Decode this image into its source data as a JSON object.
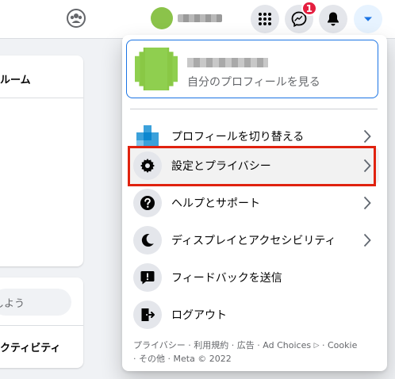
{
  "header": {
    "profile_name": "",
    "notification_count": "1",
    "icons": [
      "groups-icon",
      "menu-grid-icon",
      "messenger-icon",
      "bell-icon",
      "caret-down-icon"
    ],
    "accent_color": "#1b74e4",
    "badge_color": "#e41e3f"
  },
  "background": {
    "card1_title": "ルーム",
    "input_placeholder": "しよう",
    "card2_title": "クティビティ"
  },
  "menu": {
    "profile": {
      "name": "",
      "subtitle": "自分のプロフィールを見る"
    },
    "items": [
      {
        "label": "プロフィールを切り替える",
        "icon": "switch-profile-icon",
        "has_chevron": true
      },
      {
        "label": "設定とプライバシー",
        "icon": "gear-icon",
        "has_chevron": true,
        "highlighted": true
      },
      {
        "label": "ヘルプとサポート",
        "icon": "question-icon",
        "has_chevron": true
      },
      {
        "label": "ディスプレイとアクセシビリティ",
        "icon": "moon-icon",
        "has_chevron": true
      },
      {
        "label": "フィードバックを送信",
        "icon": "feedback-icon",
        "has_chevron": false
      },
      {
        "label": "ログアウト",
        "icon": "logout-icon",
        "has_chevron": false
      }
    ],
    "footer": {
      "privacy": "プライバシー",
      "terms": "利用規約",
      "ads": "広告",
      "ad_choices": "Ad Choices",
      "cookie": "Cookie",
      "more": "その他",
      "copyright": "Meta © 2022",
      "sep": " · "
    }
  },
  "annotation": {
    "highlight_color": "#e0220f"
  }
}
